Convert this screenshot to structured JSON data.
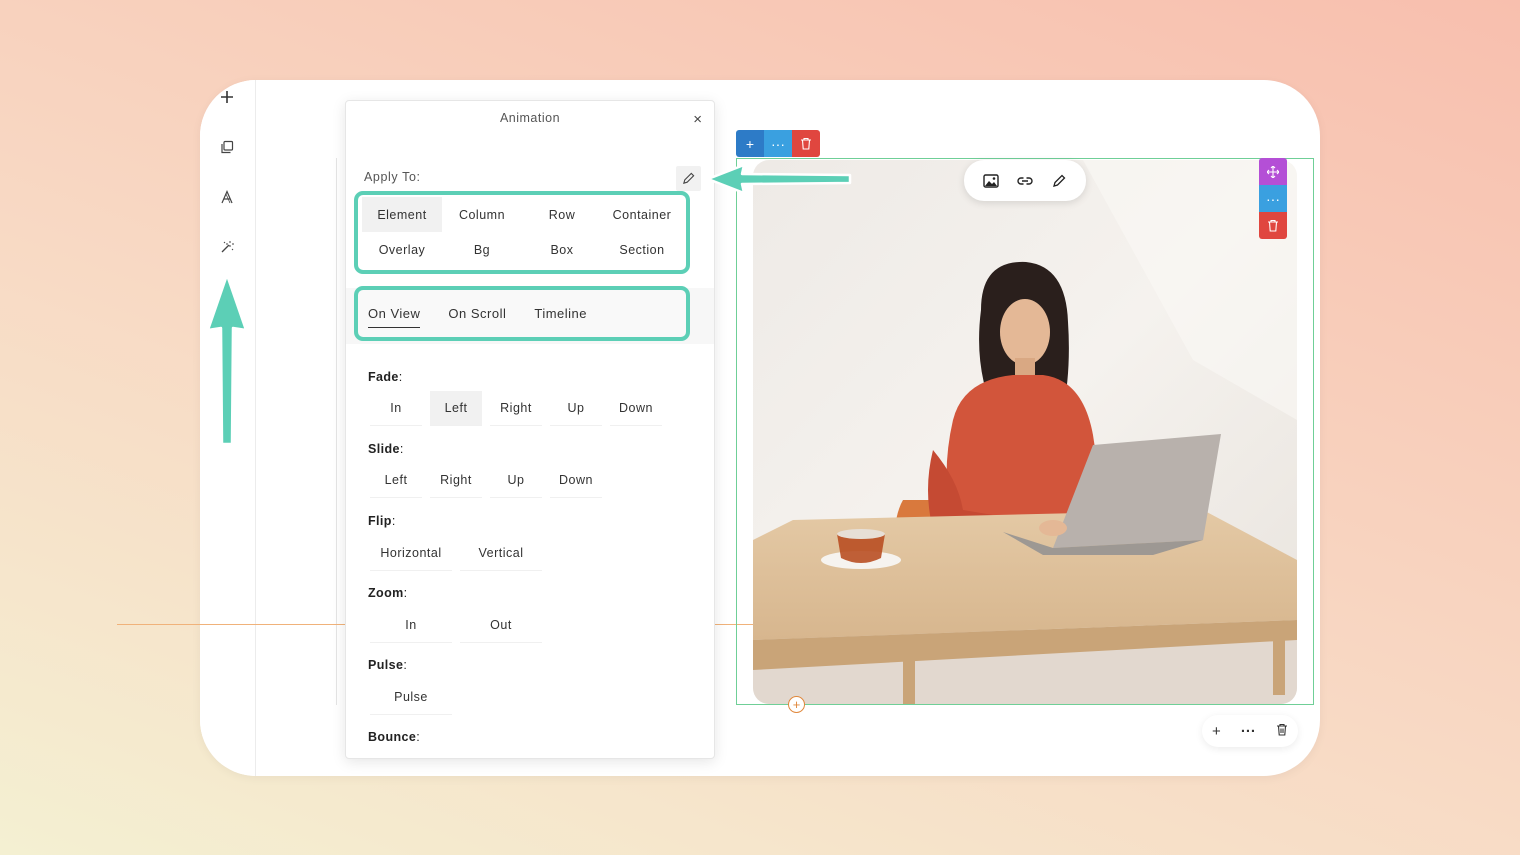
{
  "sidebar": {
    "tools": [
      {
        "icon": "plus-icon",
        "glyph": "+"
      },
      {
        "icon": "copy-icon",
        "glyph": ""
      },
      {
        "icon": "typography-icon",
        "glyph": "A"
      },
      {
        "icon": "magic-wand-icon",
        "glyph": ""
      }
    ]
  },
  "panel": {
    "title": "Animation",
    "close_glyph": "×",
    "apply_label": "Apply To:",
    "apply_options": [
      "Element",
      "Column",
      "Row",
      "Container",
      "Overlay",
      "Bg",
      "Box",
      "Section"
    ],
    "apply_active": "Element",
    "triggers": [
      "On View",
      "On Scroll",
      "Timeline"
    ],
    "trigger_active": "On View",
    "groups": {
      "fade": {
        "label": "Fade",
        "options": [
          "In",
          "Left",
          "Right",
          "Up",
          "Down"
        ],
        "active": "Left"
      },
      "slide": {
        "label": "Slide",
        "options": [
          "Left",
          "Right",
          "Up",
          "Down"
        ]
      },
      "flip": {
        "label": "Flip",
        "options": [
          "Horizontal",
          "Vertical"
        ]
      },
      "zoom": {
        "label": "Zoom",
        "options": [
          "In",
          "Out"
        ]
      },
      "pulse": {
        "label": "Pulse",
        "options": [
          "Pulse"
        ]
      },
      "bounce": {
        "label": "Bounce"
      }
    }
  },
  "element_actions": {
    "add": "+",
    "more": "···"
  },
  "bottom_toolbar": {
    "add": "+",
    "more": "···"
  },
  "colors": {
    "highlight": "#5ccfb6",
    "add_blue": "#2d7bc7",
    "more_blue": "#3aa0e0",
    "delete_red": "#e0463f",
    "move_purple": "#b44fd6",
    "selection_green": "#6fcf97"
  }
}
